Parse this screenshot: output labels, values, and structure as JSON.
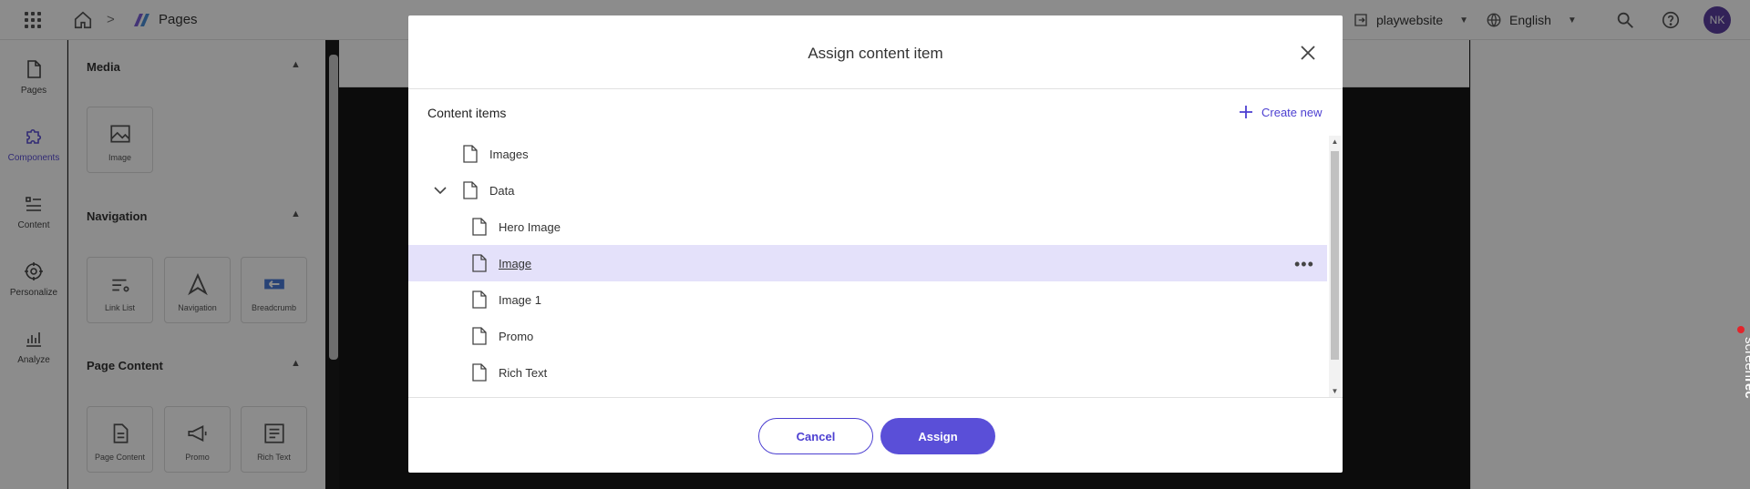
{
  "topbar": {
    "breadcrumb_separator": ">",
    "section": "Pages",
    "site": "playwebsite",
    "language": "English",
    "avatar_initials": "NK"
  },
  "rail": {
    "items": [
      {
        "label": "Pages",
        "icon": "page-icon"
      },
      {
        "label": "Components",
        "icon": "puzzle-icon",
        "active": true
      },
      {
        "label": "Content",
        "icon": "list-icon"
      },
      {
        "label": "Personalize",
        "icon": "target-icon"
      },
      {
        "label": "Analyze",
        "icon": "chart-icon"
      }
    ]
  },
  "components_panel": {
    "sections": [
      {
        "title": "Media",
        "tiles": [
          "Image"
        ]
      },
      {
        "title": "Navigation",
        "tiles": [
          "Link List",
          "Navigation",
          "Breadcrumb"
        ]
      },
      {
        "title": "Page Content",
        "tiles": [
          "Page Content",
          "Promo",
          "Rich Text"
        ]
      }
    ]
  },
  "modal": {
    "title": "Assign content item",
    "content_items_label": "Content items",
    "create_new_label": "Create new",
    "tree": [
      {
        "label": "Images",
        "depth": 0
      },
      {
        "label": "Data",
        "depth": 0,
        "expanded": true
      },
      {
        "label": "Hero Image",
        "depth": 1
      },
      {
        "label": "Image",
        "depth": 1,
        "selected": true
      },
      {
        "label": "Image 1",
        "depth": 1
      },
      {
        "label": "Promo",
        "depth": 1
      },
      {
        "label": "Rich Text",
        "depth": 1
      }
    ],
    "row_menu": "•••",
    "cancel_label": "Cancel",
    "assign_label": "Assign"
  },
  "colors": {
    "accent": "#5a4fd8",
    "selected_row": "#e4e1fa",
    "overlay": "rgba(0,0,0,0.45)"
  }
}
